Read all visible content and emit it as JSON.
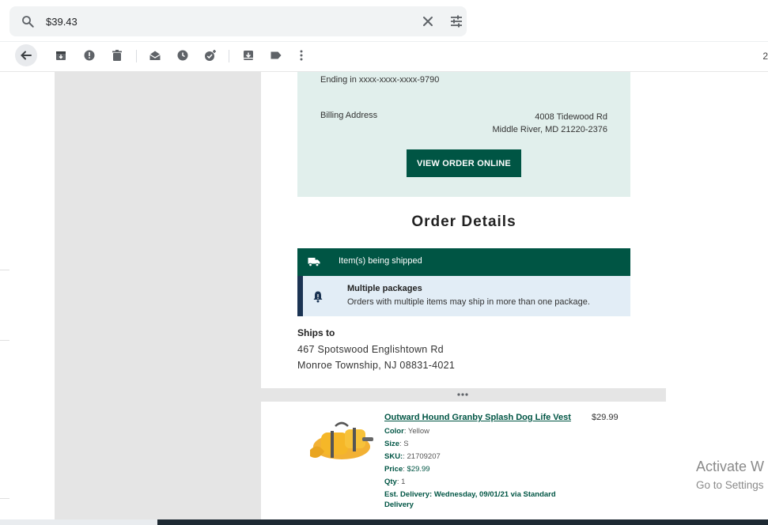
{
  "search": {
    "value": "$39.43"
  },
  "toolbar": {
    "edge_text": "2"
  },
  "payment": {
    "ending": "Ending in xxxx-xxxx-xxxx-9790",
    "billing_label": "Billing Address",
    "billing_line1": "4008 Tidewood Rd",
    "billing_line2": "Middle River, MD 21220-2376",
    "view_order": "VIEW ORDER ONLINE"
  },
  "order": {
    "title": "Order Details",
    "shipping_label": "Item(s) being shipped",
    "notice_title": "Multiple packages",
    "notice_text": "Orders with multiple items may ship in more than one package.",
    "ships_to_label": "Ships to",
    "ships_to_line1": "467 Spotswood Englishtown Rd",
    "ships_to_line2": "Monroe Township, NJ 08831-4021"
  },
  "product": {
    "name": "Outward Hound Granby Splash Dog Life Vest",
    "price": "$29.99",
    "color_label": "Color",
    "color": "Yellow",
    "size_label": "Size",
    "size": "S",
    "sku_label": "SKU:",
    "sku": "21709207",
    "price_label": "Price",
    "price_value": "$29.99",
    "qty_label": "Qty",
    "qty": "1",
    "delivery": "Est. Delivery: Wednesday, 09/01/21 via Standard Delivery"
  },
  "watermark": {
    "title": "Activate W",
    "subtitle": "Go to Settings"
  },
  "colors": {
    "brand_green": "#005544",
    "mint": "#e1efec",
    "notice_bg": "#e2edf6",
    "notice_border": "#1b3453"
  }
}
